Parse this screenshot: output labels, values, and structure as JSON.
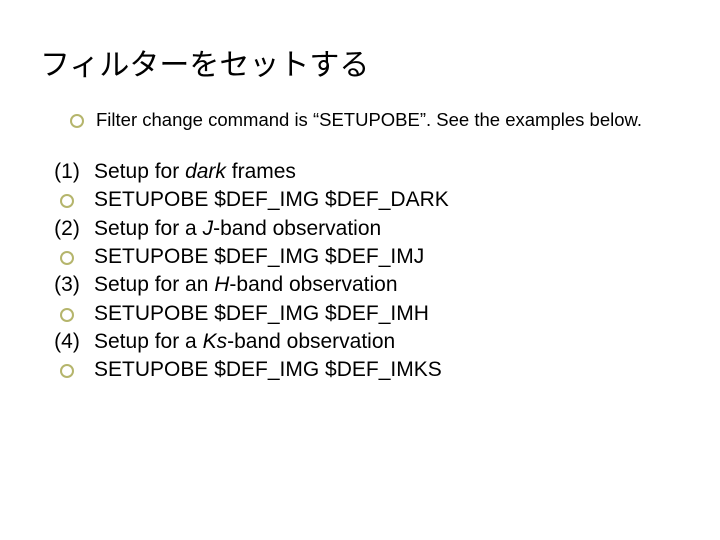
{
  "title": "フィルターをセットする",
  "intro": "Filter change command is “SETUPOBE”. See the examples below.",
  "items": [
    {
      "num": "(1)",
      "label_pre": "Setup for ",
      "label_em": "dark",
      "label_post": " frames",
      "cmd": "SETUPOBE  $DEF_IMG  $DEF_DARK"
    },
    {
      "num": "(2)",
      "label_pre": "Setup for a ",
      "label_em": "J",
      "label_post": "-band observation",
      "cmd": "SETUPOBE  $DEF_IMG  $DEF_IMJ"
    },
    {
      "num": "(3)",
      "label_pre": "Setup for an ",
      "label_em": "H",
      "label_post": "-band observation",
      "cmd": "SETUPOBE  $DEF_IMG  $DEF_IMH"
    },
    {
      "num": "(4)",
      "label_pre": "Setup for a ",
      "label_em": "Ks",
      "label_post": "-band observation",
      "cmd": "SETUPOBE   $DEF_IMG  $DEF_IMKS"
    }
  ]
}
